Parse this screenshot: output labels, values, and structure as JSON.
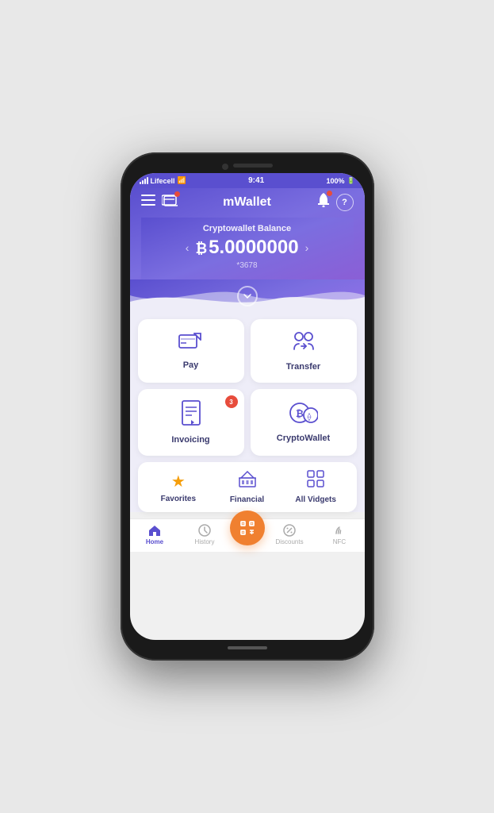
{
  "status": {
    "carrier": "Lifecell",
    "wifi": "WiFi",
    "time": "9:41",
    "battery": "100%"
  },
  "header": {
    "title": "mWallet",
    "menu_icon": "≡",
    "bell_icon": "🔔",
    "help_icon": "?"
  },
  "balance": {
    "label": "Cryptowallet Balance",
    "symbol": "₿",
    "amount": "5.0000000",
    "account": "*3678"
  },
  "cards": [
    {
      "id": "pay",
      "label": "Pay",
      "icon": "pay",
      "badge": null
    },
    {
      "id": "transfer",
      "label": "Transfer",
      "icon": "transfer",
      "badge": null
    },
    {
      "id": "invoicing",
      "label": "Invoicing",
      "icon": "invoicing",
      "badge": "3"
    },
    {
      "id": "cryptowallet",
      "label": "CryptoWallet",
      "icon": "cryptowallet",
      "badge": null
    }
  ],
  "bottom_row": [
    {
      "id": "favorites",
      "label": "Favorites",
      "icon": "★",
      "type": "star"
    },
    {
      "id": "financial",
      "label": "Financial",
      "icon": "bank",
      "type": "bank"
    },
    {
      "id": "all_widgets",
      "label": "All Vidgets",
      "icon": "grid",
      "type": "grid"
    }
  ],
  "tabs": [
    {
      "id": "home",
      "label": "Home",
      "icon": "home",
      "active": true
    },
    {
      "id": "history",
      "label": "History",
      "icon": "clock",
      "active": false
    },
    {
      "id": "scan",
      "label": "",
      "icon": "scan",
      "active": false,
      "special": true
    },
    {
      "id": "discounts",
      "label": "Discounts",
      "icon": "percent",
      "active": false
    },
    {
      "id": "nfc",
      "label": "NFC",
      "icon": "nfc",
      "active": false
    }
  ],
  "colors": {
    "primary": "#5a4fcf",
    "accent": "#f08030",
    "badge": "#e74c3c",
    "star": "#f59e0b"
  }
}
